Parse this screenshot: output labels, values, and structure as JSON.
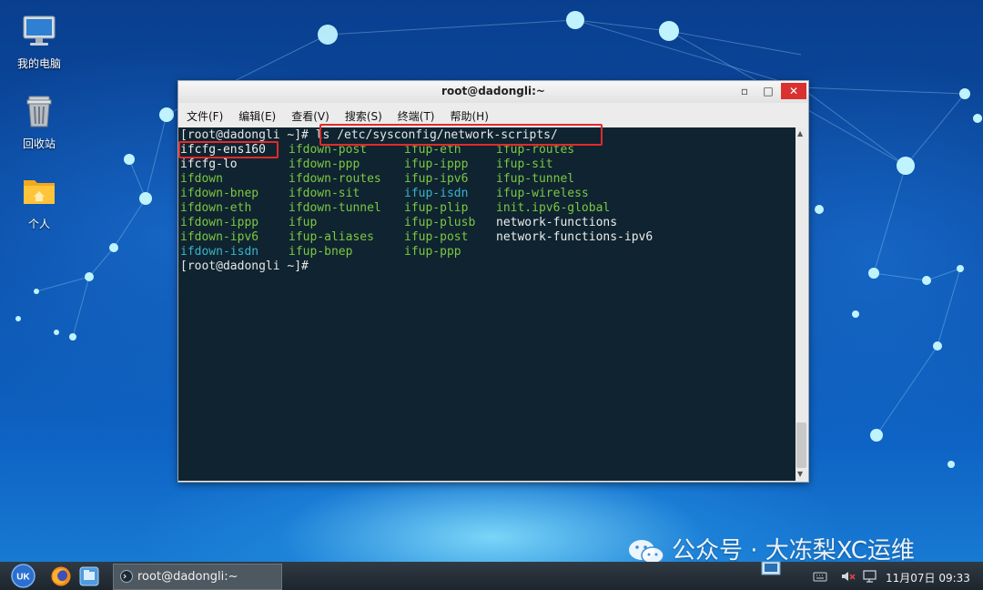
{
  "desktop": {
    "icons": [
      {
        "label": "我的电脑",
        "icon": "computer-icon"
      },
      {
        "label": "回收站",
        "icon": "trash-icon"
      },
      {
        "label": "个人",
        "icon": "home-folder-icon"
      }
    ]
  },
  "window": {
    "title": "root@dadongli:~",
    "controls": {
      "minimize": "▫",
      "maximize": "□",
      "close": "✕"
    }
  },
  "menu": [
    "文件(F)",
    "编辑(E)",
    "查看(V)",
    "搜索(S)",
    "终端(T)",
    "帮助(H)"
  ],
  "terminal": {
    "prompt": "[root@dadongli ~]#",
    "command": " ls /etc/sysconfig/network-scripts/",
    "listing": [
      [
        "ifcfg-ens160",
        "ifdown-post",
        "ifup-eth",
        "ifup-routes"
      ],
      [
        "ifcfg-lo",
        "ifdown-ppp",
        "ifup-ippp",
        "ifup-sit"
      ],
      [
        "ifdown",
        "ifdown-routes",
        "ifup-ipv6",
        "ifup-tunnel"
      ],
      [
        "ifdown-bnep",
        "ifdown-sit",
        "ifup-isdn",
        "ifup-wireless"
      ],
      [
        "ifdown-eth",
        "ifdown-tunnel",
        "ifup-plip",
        "init.ipv6-global"
      ],
      [
        "ifdown-ippp",
        "ifup",
        "ifup-plusb",
        "network-functions"
      ],
      [
        "ifdown-ipv6",
        "ifup-aliases",
        "ifup-post",
        "network-functions-ipv6"
      ],
      [
        "ifdown-isdn",
        "ifup-bnep",
        "ifup-ppp",
        ""
      ]
    ],
    "last_prompt": "[root@dadongli ~]#",
    "colors": {
      "background": "#0f2430",
      "executable": "#7dc743",
      "link": "#39b4c9",
      "regular": "#ececec",
      "highlight": "#e3292a"
    }
  },
  "watermark": "公众号 · 大冻梨XC运维",
  "taskbar": {
    "task_label": "root@dadongli:~",
    "datetime": "11月07日 09:33"
  }
}
